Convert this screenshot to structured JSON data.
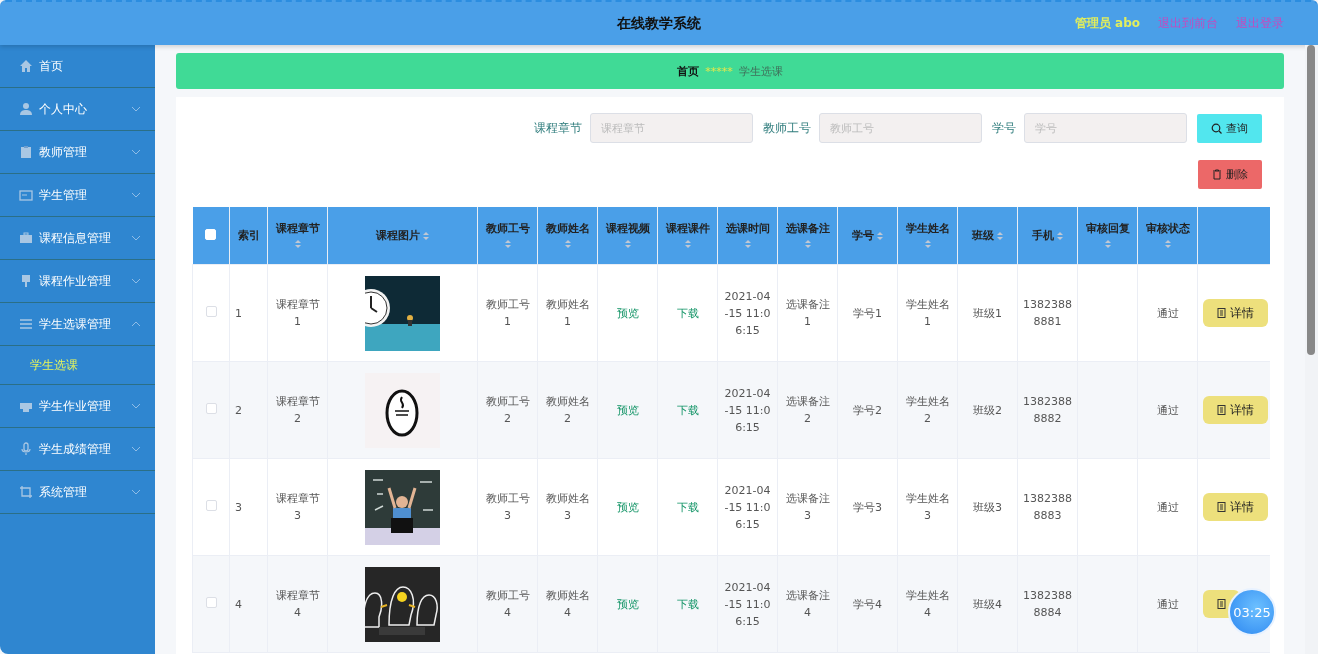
{
  "header": {
    "title": "在线教学系统",
    "links": [
      {
        "text": "管理员 abo",
        "kind": "user"
      },
      {
        "text": "退出到前台",
        "kind": "link"
      },
      {
        "text": "退出登录",
        "kind": "link"
      }
    ]
  },
  "sidebar": {
    "items": [
      {
        "label": "首页"
      },
      {
        "label": "个人中心",
        "expanded": false
      },
      {
        "label": "教师管理",
        "expanded": false
      },
      {
        "label": "学生管理",
        "expanded": false
      },
      {
        "label": "课程信息管理",
        "expanded": false
      },
      {
        "label": "课程作业管理",
        "expanded": false
      },
      {
        "label": "学生选课管理",
        "expanded": true,
        "children": [
          {
            "label": "学生选课",
            "selected": true
          }
        ]
      },
      {
        "label": "学生作业管理",
        "expanded": false
      },
      {
        "label": "学生成绩管理",
        "expanded": false
      },
      {
        "label": "系统管理",
        "expanded": false
      }
    ]
  },
  "breadcrumb": {
    "items": [
      {
        "text": "首页",
        "current": false
      },
      {
        "text": "学生选课",
        "current": true
      }
    ],
    "separator": "*****"
  },
  "search": {
    "fields": [
      {
        "label": "课程章节",
        "placeholder": "课程章节"
      },
      {
        "label": "教师工号",
        "placeholder": "教师工号"
      },
      {
        "label": "学号",
        "placeholder": "学号"
      }
    ],
    "buttons": [
      {
        "text": "查询",
        "kind": "search"
      }
    ]
  },
  "actions": [
    {
      "text": "删除",
      "kind": "delete"
    }
  ],
  "table": {
    "select_all": {
      "checked": false
    },
    "columns": [
      {
        "label": "索引",
        "sortable": false
      },
      {
        "label": "课程章节",
        "sortable": true
      },
      {
        "label": "课程图片",
        "sortable": true
      },
      {
        "label": "教师工号",
        "sortable": true
      },
      {
        "label": "教师姓名",
        "sortable": true
      },
      {
        "label": "课程视频",
        "sortable": true
      },
      {
        "label": "课程课件",
        "sortable": true
      },
      {
        "label": "选课时间",
        "sortable": true
      },
      {
        "label": "选课备注",
        "sortable": true
      },
      {
        "label": "学号",
        "sortable": true
      },
      {
        "label": "学生姓名",
        "sortable": true
      },
      {
        "label": "班级",
        "sortable": true
      },
      {
        "label": "手机",
        "sortable": true
      },
      {
        "label": "审核回复",
        "sortable": true
      },
      {
        "label": "审核状态",
        "sortable": true
      }
    ],
    "rows": [
      {
        "checked": false,
        "index": "1",
        "chapter": "课程章节1",
        "teacher_no": "教师工号1",
        "teacher_name": "教师姓名1",
        "video": "预览",
        "courseware": "下载",
        "time": "2021-04-15 11:06:15",
        "note": "选课备注1",
        "student_no": "学号1",
        "student_name": "学生姓名1",
        "class": "班级1",
        "phone": "13823888881",
        "status": "通过",
        "action": "详情"
      },
      {
        "checked": false,
        "index": "2",
        "chapter": "课程章节2",
        "teacher_no": "教师工号2",
        "teacher_name": "教师姓名2",
        "video": "预览",
        "courseware": "下载",
        "time": "2021-04-15 11:06:15",
        "note": "选课备注2",
        "student_no": "学号2",
        "student_name": "学生姓名2",
        "class": "班级2",
        "phone": "13823888882",
        "status": "通过",
        "action": "详情"
      },
      {
        "checked": false,
        "index": "3",
        "chapter": "课程章节3",
        "teacher_no": "教师工号3",
        "teacher_name": "教师姓名3",
        "video": "预览",
        "courseware": "下载",
        "time": "2021-04-15 11:06:15",
        "note": "选课备注3",
        "student_no": "学号3",
        "student_name": "学生姓名3",
        "class": "班级3",
        "phone": "13823888883",
        "status": "通过",
        "action": "详情"
      },
      {
        "checked": false,
        "index": "4",
        "chapter": "课程章节4",
        "teacher_no": "教师工号4",
        "teacher_name": "教师姓名4",
        "video": "预览",
        "courseware": "下载",
        "time": "2021-04-15 11:06:15",
        "note": "选课备注4",
        "student_no": "学号4",
        "student_name": "学生姓名4",
        "class": "班级4",
        "phone": "13823888884",
        "status": "通过"
      }
    ]
  },
  "timer": "03:25"
}
